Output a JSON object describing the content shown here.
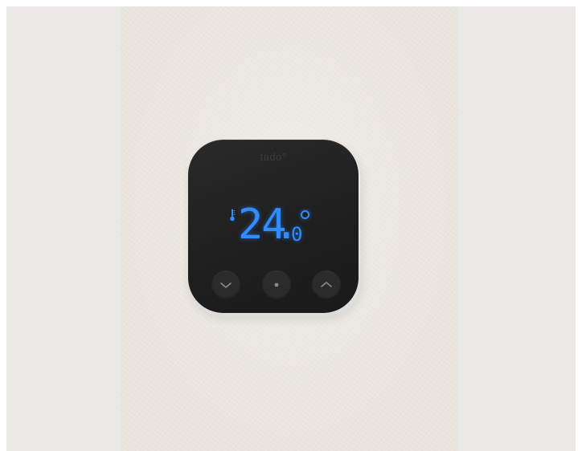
{
  "device": {
    "brand": "tado°",
    "temperature_integer": "24",
    "temperature_decimal": ".",
    "temperature_fraction": "0"
  },
  "colors": {
    "display_blue": "#2f8dff",
    "device_body": "#1f1f20",
    "wall": "#ebe7df"
  },
  "icons": {
    "thermometer": "thermometer-icon",
    "down": "chevron-down-icon",
    "center": "dot-icon",
    "up": "chevron-up-icon"
  }
}
